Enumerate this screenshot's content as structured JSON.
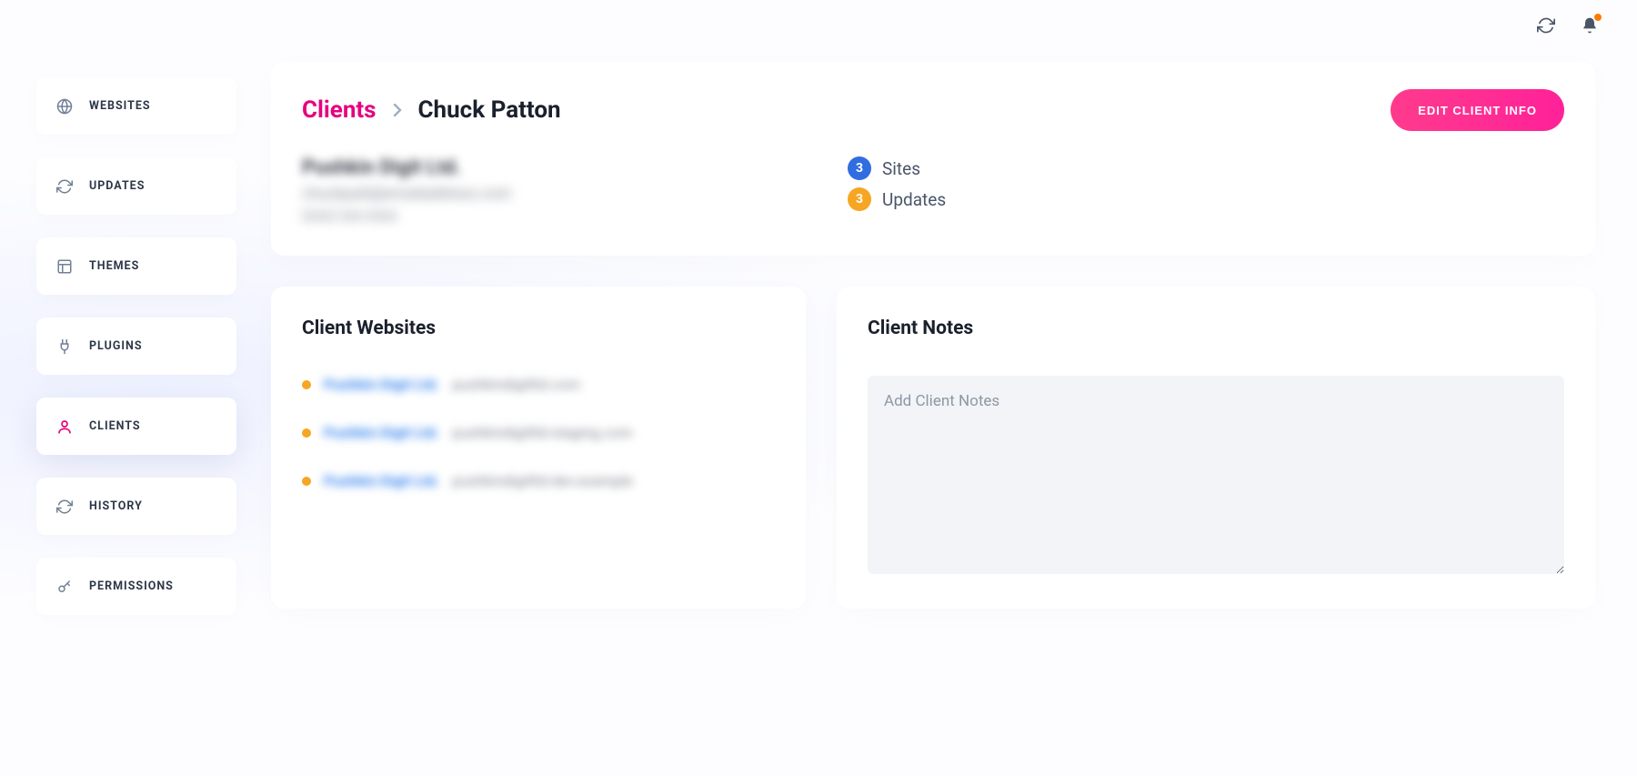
{
  "topbar": {
    "refresh_icon": "refresh",
    "bell_icon": "bell"
  },
  "sidebar": {
    "items": [
      {
        "label": "WEBSITES",
        "icon": "globe"
      },
      {
        "label": "UPDATES",
        "icon": "refresh"
      },
      {
        "label": "THEMES",
        "icon": "layout"
      },
      {
        "label": "PLUGINS",
        "icon": "plug"
      },
      {
        "label": "CLIENTS",
        "icon": "user",
        "active": true
      },
      {
        "label": "HISTORY",
        "icon": "refresh"
      },
      {
        "label": "PERMISSIONS",
        "icon": "key"
      }
    ]
  },
  "header": {
    "breadcrumb_link": "Clients",
    "breadcrumb_current": "Chuck Patton",
    "edit_button": "EDIT CLIENT INFO"
  },
  "client": {
    "name_blurred": "Pushkin Digit Ltd.",
    "email_blurred": "chuckpatt@emailaddress.com",
    "phone_blurred": "(xxx) xxx-xxxx",
    "stats": {
      "sites_count": "3",
      "sites_label": "Sites",
      "updates_count": "3",
      "updates_label": "Updates"
    }
  },
  "client_websites": {
    "title": "Client Websites",
    "items": [
      {
        "name_blurred": "Pushkin Digit Ltd.",
        "url_blurred": "pushkindigitltd.com"
      },
      {
        "name_blurred": "Pushkin Digit Ltd.",
        "url_blurred": "pushkindigitltd-staging.com"
      },
      {
        "name_blurred": "Pushkin Digit Ltd.",
        "url_blurred": "pushkindigitltd-dev.example"
      }
    ]
  },
  "client_notes": {
    "title": "Client Notes",
    "placeholder": "Add Client Notes",
    "value": ""
  }
}
